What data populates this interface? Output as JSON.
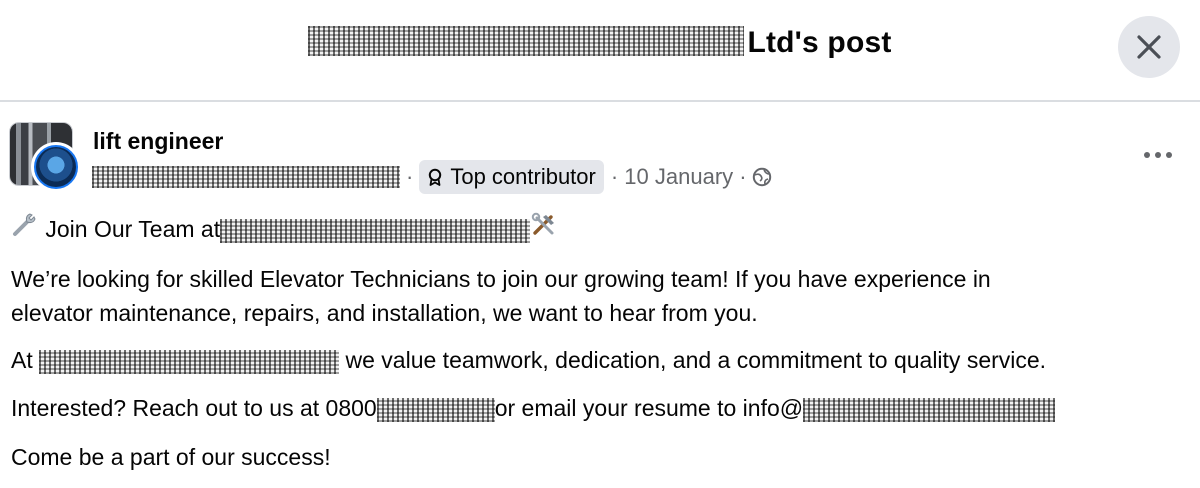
{
  "header": {
    "title_suffix": "Ltd's post",
    "close_label": "Close"
  },
  "post": {
    "author": "lift engineer",
    "separator_1": "·",
    "badge": "Top contributor",
    "date": "· 10 January ·",
    "lines": {
      "join_prefix": "Join Our Team at",
      "line2": "We’re looking for skilled Elevator Technicians to join our growing team! If you have experience in",
      "line3": "elevator maintenance, repairs, and installation, we want to hear from you.",
      "line4_prefix": "At",
      "line4_suffix": "we value teamwork, dedication, and a commitment to quality service.",
      "line5_prefix": "Interested? Reach out to us at 0800",
      "line5_middle": "or email your resume to info@",
      "line6": "Come be a part of our success!"
    }
  },
  "icons": {
    "close": "close-icon",
    "more": "more-options-icon",
    "badge": "top-contributor-badge-icon",
    "privacy": "globe-icon",
    "wrench": "wrench-emoji-icon",
    "tools": "hammer-and-wrench-emoji-icon"
  }
}
